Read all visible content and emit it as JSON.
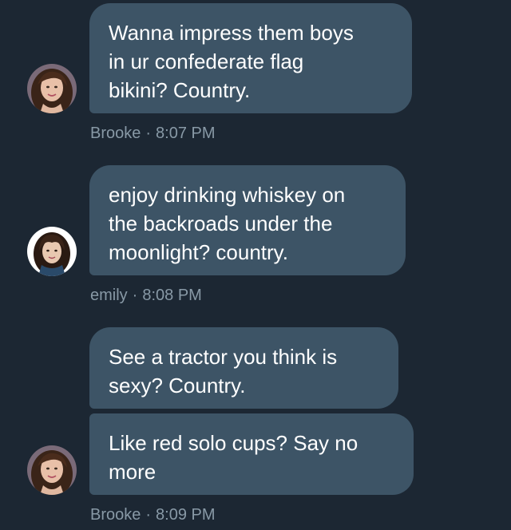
{
  "colors": {
    "background": "#1c2733",
    "bubble": "#3d5466",
    "bubble_text": "#ffffff",
    "meta_text": "#8899a6"
  },
  "messages": [
    {
      "text": "Wanna impress them boys\nin ur confederate flag\nbikini? Country.",
      "author": "Brooke",
      "separator": "·",
      "time": "8:07 PM",
      "avatar_icon": "avatar-brooke"
    },
    {
      "text": "enjoy drinking whiskey on\nthe backroads under the\nmoonlight? country.",
      "author": "emily",
      "separator": "·",
      "time": "8:08 PM",
      "avatar_icon": "avatar-emily"
    },
    {
      "texts": [
        "See a tractor you think is\nsexy? Country.",
        "Like red solo cups? Say no\nmore"
      ],
      "author": "Brooke",
      "separator": "·",
      "time": "8:09 PM",
      "avatar_icon": "avatar-brooke"
    }
  ]
}
